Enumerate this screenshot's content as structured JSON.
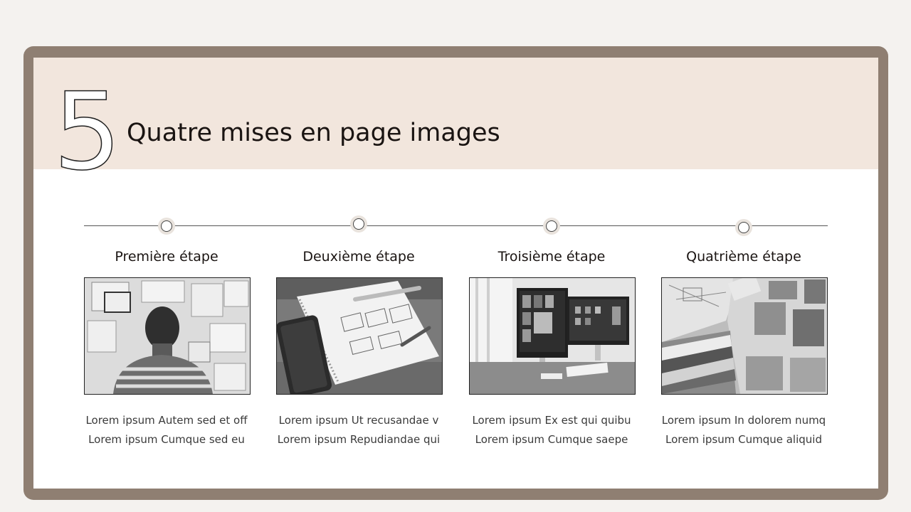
{
  "slide": {
    "number": "5",
    "title": "Quatre mises en page images"
  },
  "steps": [
    {
      "heading": "Première étape",
      "line1": "Lorem ipsum Autem sed et off",
      "line2": "Lorem ipsum Cumque sed eu"
    },
    {
      "heading": "Deuxième étape",
      "line1": "Lorem ipsum Ut recusandae v",
      "line2": "Lorem ipsum Repudiandae qui"
    },
    {
      "heading": "Troisième étape",
      "line1": "Lorem ipsum Ex est qui quibu",
      "line2": "Lorem ipsum Cumque saepe"
    },
    {
      "heading": "Quatrième étape",
      "line1": "Lorem ipsum In dolorem numq",
      "line2": "Lorem ipsum Cumque aliquid"
    }
  ],
  "colors": {
    "frame": "#8f7f72",
    "header_band": "#f2e6dd",
    "background": "#f4f2ef"
  }
}
